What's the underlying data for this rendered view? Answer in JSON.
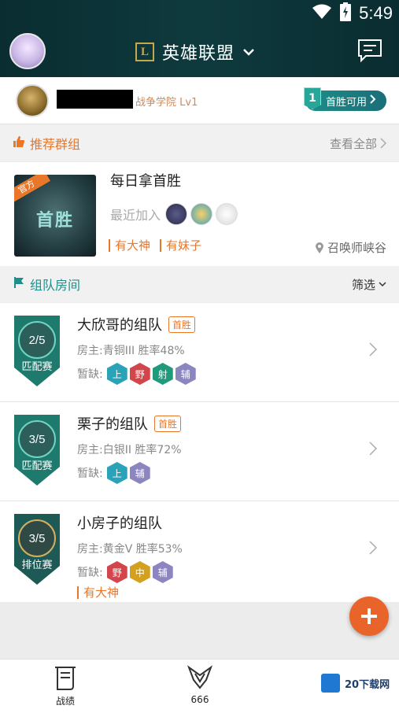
{
  "status_bar": {
    "time": "5:49"
  },
  "header": {
    "game_title": "英雄联盟",
    "logo_letter": "L"
  },
  "user": {
    "level_text": "战争学院 Lv1",
    "first_win_count": "1",
    "first_win_label": "首胜可用"
  },
  "recommended": {
    "section_title": "推荐群组",
    "view_all": "查看全部",
    "group": {
      "official_badge": "官方",
      "thumb_text": "首胜",
      "name": "每日拿首胜",
      "recent_label": "最近加入",
      "tags": [
        "有大神",
        "有妹子"
      ],
      "location": "召唤师峡谷"
    }
  },
  "rooms_section": {
    "title": "组队房间",
    "filter": "筛选"
  },
  "rooms": [
    {
      "count": "2/5",
      "mode": "匹配赛",
      "name": "大欣哥的组队",
      "badge": "首胜",
      "host": "房主:青铜III  胜率48%",
      "lack_label": "暂缺:",
      "roles": [
        {
          "t": "上",
          "c": "#2aa3b8"
        },
        {
          "t": "野",
          "c": "#d2454a"
        },
        {
          "t": "射",
          "c": "#1f9a7a"
        },
        {
          "t": "辅",
          "c": "#8c86c0"
        }
      ],
      "tag": ""
    },
    {
      "count": "3/5",
      "mode": "匹配赛",
      "name": "栗子的组队",
      "badge": "首胜",
      "host": "房主:白银II  胜率72%",
      "lack_label": "暂缺:",
      "roles": [
        {
          "t": "上",
          "c": "#2aa3b8"
        },
        {
          "t": "辅",
          "c": "#8c86c0"
        }
      ],
      "tag": ""
    },
    {
      "count": "3/5",
      "mode": "排位赛",
      "name": "小房子的组队",
      "badge": "",
      "host": "房主:黄金V  胜率53%",
      "lack_label": "暂缺:",
      "roles": [
        {
          "t": "野",
          "c": "#d2454a"
        },
        {
          "t": "中",
          "c": "#d4a020"
        },
        {
          "t": "辅",
          "c": "#8c86c0"
        }
      ],
      "tag": "有大神"
    }
  ],
  "tabs": [
    {
      "label": "战绩"
    },
    {
      "label": "666"
    }
  ],
  "watermark": "20下载网",
  "colors": {
    "accent": "#e8772a",
    "teal": "#1d8f8a",
    "header_bg": "#0e3a3e"
  }
}
